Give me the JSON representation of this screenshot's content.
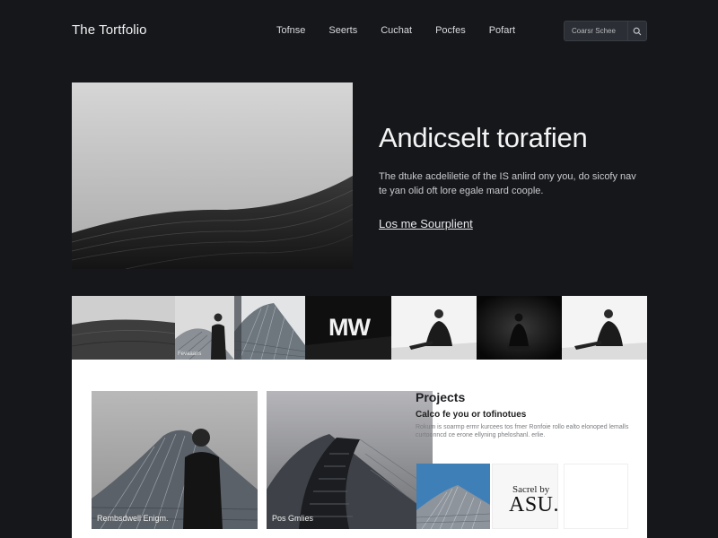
{
  "header": {
    "brand": "The Tortfolio",
    "nav": [
      "Tofnse",
      "Seerts",
      "Cuchat",
      "Pocfes",
      "Pofart"
    ],
    "search": {
      "placeholder": "Coarsr Schee"
    }
  },
  "hero": {
    "title": "Andicselt torafien",
    "description": "The dtuke acdeliletie of the IS anlird ony you, do sicofy nav te yan olid oft lore egale mard coople.",
    "link": "Los me Sourplient"
  },
  "strip": {
    "thumb_caption": "Fevaaans",
    "mw_text": "MW"
  },
  "projects": {
    "card1_caption": "Rembsdwell Enigm.",
    "card2_caption": "Pos Gmlies",
    "title": "Projects",
    "subtitle": "Calco fe you or tofinotues",
    "text": "Rokum is soarmp ermr kurcees tos fmer Ronfoie rollo ealto elonoped lemalls curtoonncd ce erone ellyning pheloshanl. erlie.",
    "asu_small": "Sacrel by",
    "asu_big": "ASU."
  },
  "colors": {
    "background": "#15171b",
    "panel": "#ffffff",
    "accent_text": "#f4f4f4"
  },
  "icons": [
    "search-icon"
  ]
}
